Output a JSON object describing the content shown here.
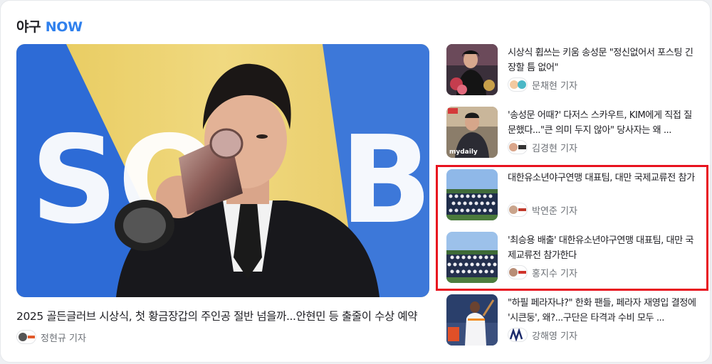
{
  "section": {
    "title_main": "야구",
    "title_accent": "NOW",
    "accent_color": "#2f80ed"
  },
  "hero": {
    "title": "2025 골든글러브 시상식, 첫 황금장갑의 주인공 절반 넘을까...안현민 등 출줄이 수상 예약",
    "author": "정현규 기자",
    "photo_text": "SOL B"
  },
  "articles": [
    {
      "title": "시상식 휩쓰는 키움 송성문 \"정신없어서 포스팅 긴장할 틈 없어\"",
      "author": "문채현 기자"
    },
    {
      "title": "'송성문 어때?' 다저스 스카우트, KIM에게 직접 질문했다...\"큰 의미 두지 않아\" 당사자는 왜 ...",
      "author": "김경현 기자",
      "watermark": "mydaily"
    },
    {
      "title": "대한유소년야구연맹 대표팀, 대만 국제교류전 참가",
      "author": "박연준 기자"
    },
    {
      "title": "'최승용 배출' 대한유소년야구연맹 대표팀, 대만 국제교류전 참가한다",
      "author": "홍지수 기자"
    },
    {
      "title": "\"하필 페라자냐?\" 한화 팬들, 페라자 재영입 결정에 '시큰둥', 왜?...구단은 타격과 수비 모두 ...",
      "author": "강해영 기자"
    }
  ],
  "highlight_color": "#e8121e"
}
